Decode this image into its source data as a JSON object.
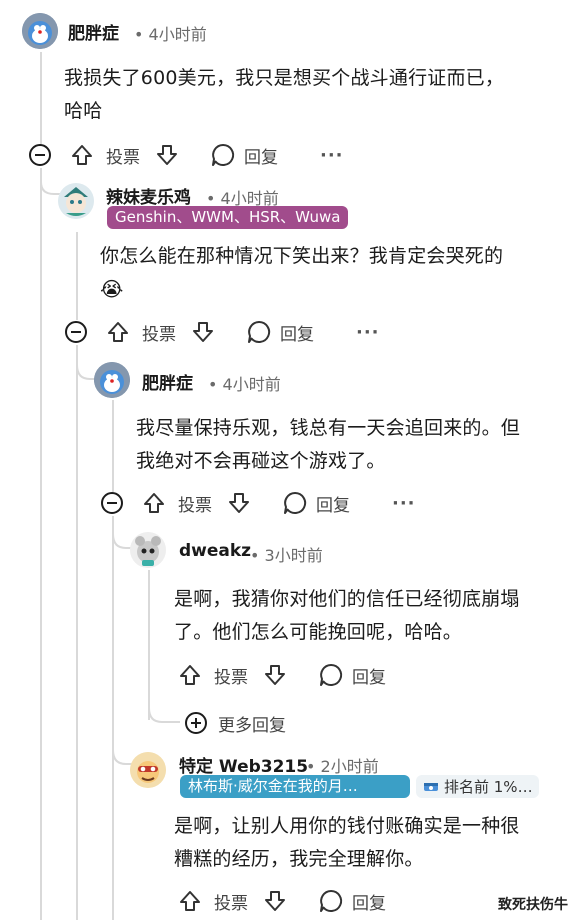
{
  "c1": {
    "user": "肥胖症",
    "time": "• 4小时前",
    "text_line1": "我损失了600美元，我只是想买个战斗通行证而已，",
    "text_line2": "哈哈",
    "vote_label": "投票",
    "reply_label": "回复",
    "more": "···"
  },
  "c2": {
    "user": "辣妹麦乐鸡",
    "time": "• 4小时前",
    "flair": "Genshin、WWM、HSR、Wuwa",
    "text_line1": "你怎么能在那种情况下笑出来？我肯定会哭死的",
    "emoji": "😭",
    "vote_label": "投票",
    "reply_label": "回复",
    "more": "···"
  },
  "c3": {
    "user": "肥胖症",
    "time": "• 4小时前",
    "text_line1": "我尽量保持乐观，钱总有一天会追回来的。但",
    "text_line2": "我绝对不会再碰这个游戏了。",
    "vote_label": "投票",
    "reply_label": "回复",
    "more": "···"
  },
  "c4": {
    "user": "dweakz",
    "time": "• 3小时前",
    "text_line1": "是啊，我猜你对他们的信任已经彻底崩塌",
    "text_line2": "了。他们怎么可能挽回呢，哈哈。",
    "vote_label": "投票",
    "reply_label": "回复"
  },
  "more_replies": "更多回复",
  "c5": {
    "user": "特定 Web3215",
    "time": "• 2小时前",
    "flair": "林布斯·威尔金在我的月…",
    "rank_badge": "排名前 1%…",
    "text_line1": "是啊，让别人用你的钱付账确实是一种很",
    "text_line2": "糟糕的经历，我完全理解你。",
    "vote_label": "投票",
    "reply_label": "回复"
  },
  "watermark": "致死扶伤牛",
  "colors": {
    "flair1": "#a14c8c",
    "flair2": "#3b9fc6",
    "badge_bg": "#eef3f6"
  }
}
